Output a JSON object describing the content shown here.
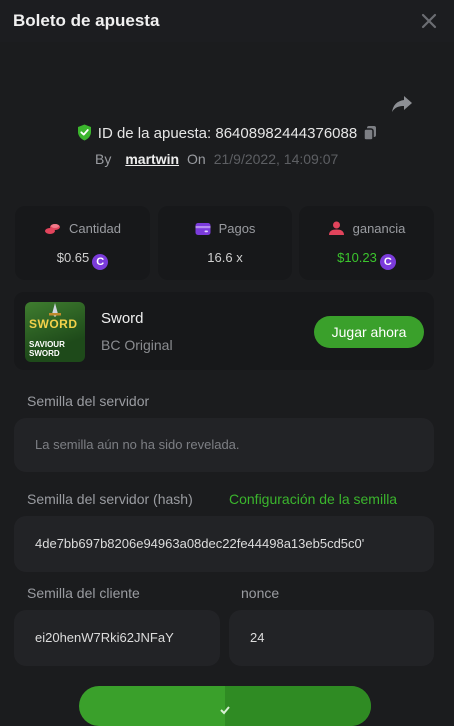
{
  "header": {
    "title": "Boleto de apuesta"
  },
  "bet": {
    "id_label": "ID de la apuesta:",
    "id_value": "86408982444376088",
    "by_label": "By",
    "username": "martwin",
    "on_label": "On",
    "date": "21/9/2022, 14:09:07"
  },
  "stats": [
    {
      "label": "Cantidad",
      "value": "$0.65",
      "icon": "coins-icon",
      "value_color": "#d0d0d0"
    },
    {
      "label": "Pagos",
      "value": "16.6 x",
      "icon": "wallet-icon",
      "value_color": "#d0d0d0"
    },
    {
      "label": "ganancia",
      "value": "$10.23",
      "icon": "profit-icon",
      "value_color": "#3bc42d"
    }
  ],
  "game": {
    "thumb_title": "SWORD",
    "thumb_sub": "SAVIOUR SWORD",
    "name": "Sword",
    "provider": "BC Original",
    "play_label": "Jugar ahora"
  },
  "server_seed": {
    "label": "Semilla del servidor",
    "value": "La semilla aún no ha sido revelada."
  },
  "server_hash": {
    "label": "Semilla del servidor (hash)",
    "link": "Configuración de la semilla",
    "value": "4de7bb697b8206e94963a08dec22fe44498a13eb5cd5c0'"
  },
  "client_seed": {
    "label": "Semilla del cliente",
    "value": "ei20henW7Rki62JNFaY"
  },
  "nonce": {
    "label": "nonce",
    "value": "24"
  },
  "colors": {
    "accent": "#3aa02b",
    "link": "#3bb52d",
    "coin": "#7b3bdb"
  }
}
